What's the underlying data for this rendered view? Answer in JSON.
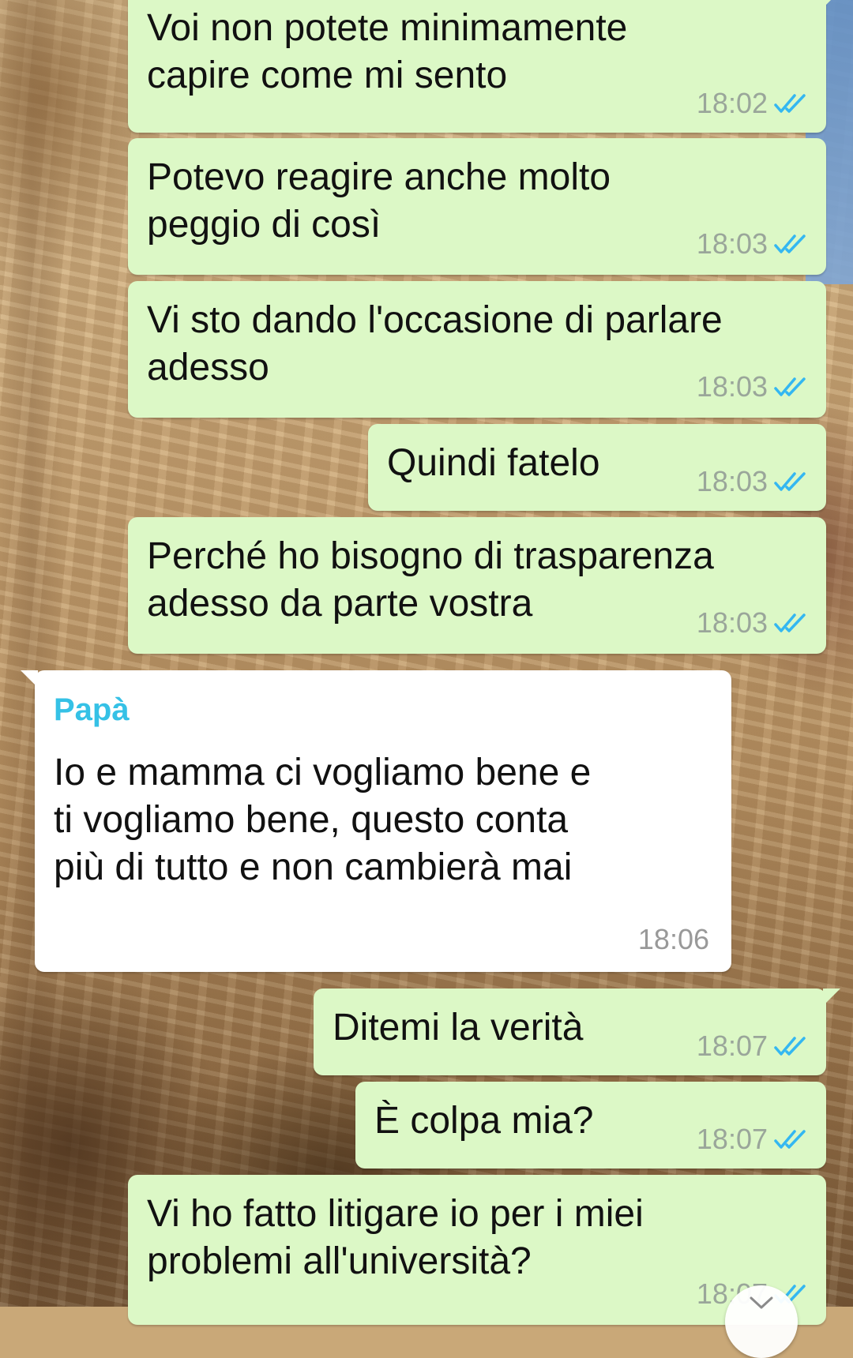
{
  "chat": {
    "messages": [
      {
        "direction": "out",
        "text": "Voi non potete minimamente\ncapire come mi sento",
        "time": "18:02",
        "status": "read"
      },
      {
        "direction": "out",
        "text": "Potevo reagire anche molto\npeggio di così",
        "time": "18:03",
        "status": "read"
      },
      {
        "direction": "out",
        "text": "Vi sto dando l'occasione di parlare\nadesso",
        "time": "18:03",
        "status": "read"
      },
      {
        "direction": "out",
        "text": "Quindi fatelo",
        "time": "18:03",
        "status": "read"
      },
      {
        "direction": "out",
        "text": "Perché ho bisogno di trasparenza\nadesso da parte vostra",
        "time": "18:03",
        "status": "read"
      },
      {
        "direction": "in",
        "sender": "Papà",
        "text": "Io e mamma ci vogliamo bene e\nti vogliamo bene, questo conta\npiù di tutto e non cambierà mai",
        "time": "18:06"
      },
      {
        "direction": "out",
        "text": "Ditemi la verità",
        "time": "18:07",
        "status": "read"
      },
      {
        "direction": "out",
        "text": "È colpa mia?",
        "time": "18:07",
        "status": "read"
      },
      {
        "direction": "out",
        "text": "Vi ho fatto litigare io per i miei\nproblemi all'università?",
        "time": "18:07",
        "status": "read"
      }
    ]
  },
  "icons": {
    "read_receipt": "double-check-icon",
    "scroll_down": "chevron-down-icon"
  },
  "colors": {
    "outgoing_bubble": "#dcf8c6",
    "incoming_bubble": "#ffffff",
    "sender_name": "#35c1e6",
    "read_ticks": "#34b7f1",
    "timestamp": "#9aa69a"
  }
}
